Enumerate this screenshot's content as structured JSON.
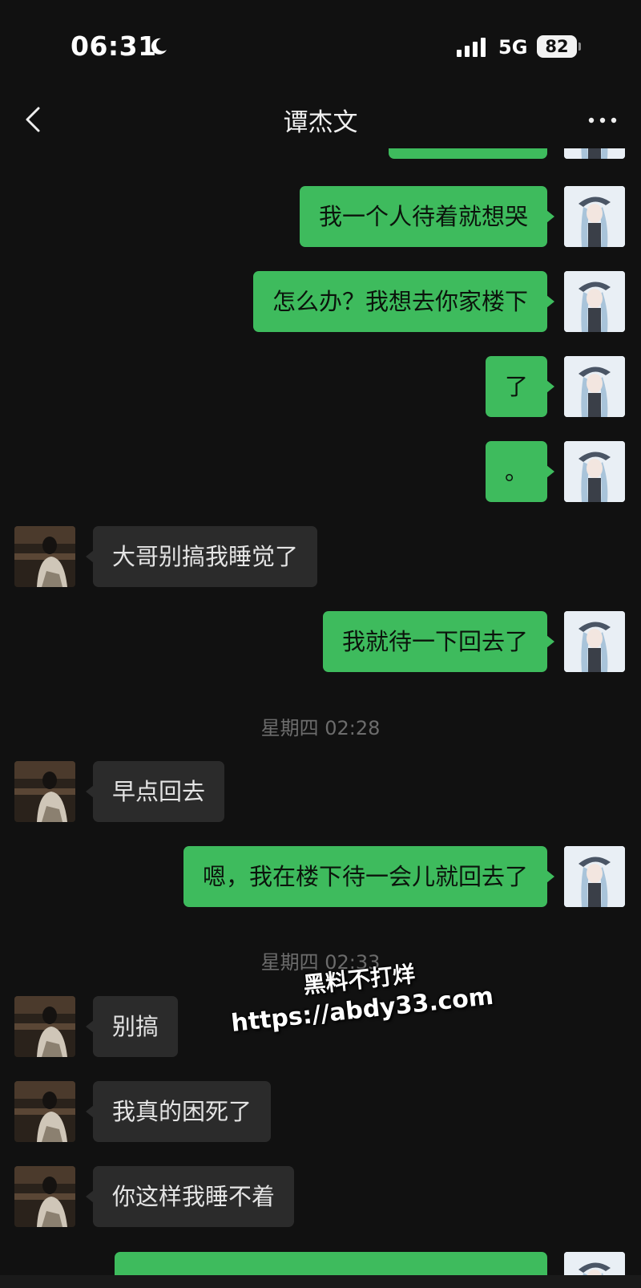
{
  "status_bar": {
    "time": "06:31",
    "network": "5G",
    "battery": "82"
  },
  "nav": {
    "title": "谭杰文"
  },
  "messages": [
    {
      "side": "me",
      "text": "我一个人待着就想哭"
    },
    {
      "side": "me",
      "text": "怎么办？我想去你家楼下"
    },
    {
      "side": "me",
      "text": "了"
    },
    {
      "side": "me",
      "text": "。"
    },
    {
      "side": "them",
      "text": "大哥别搞我睡觉了"
    },
    {
      "side": "me",
      "text": "我就待一下回去了"
    },
    {
      "timestamp": "星期四 02:28"
    },
    {
      "side": "them",
      "text": "早点回去"
    },
    {
      "side": "me",
      "text": "嗯，我在楼下待一会儿就回去了"
    },
    {
      "timestamp": "星期四 02:33"
    },
    {
      "side": "them",
      "text": "别搞"
    },
    {
      "side": "them",
      "text": "我真的困死了"
    },
    {
      "side": "them",
      "text": "你这样我睡不着"
    }
  ],
  "watermark": {
    "line1": "黑料不打烊",
    "line2": "https://abdy33.com"
  },
  "colors": {
    "background": "#111111",
    "my_bubble": "#3ebb5d",
    "their_bubble": "#2b2b2b"
  },
  "icons": {
    "back": "chevron-left-icon",
    "more": "more-horizontal-icon",
    "moon": "moon-icon"
  }
}
